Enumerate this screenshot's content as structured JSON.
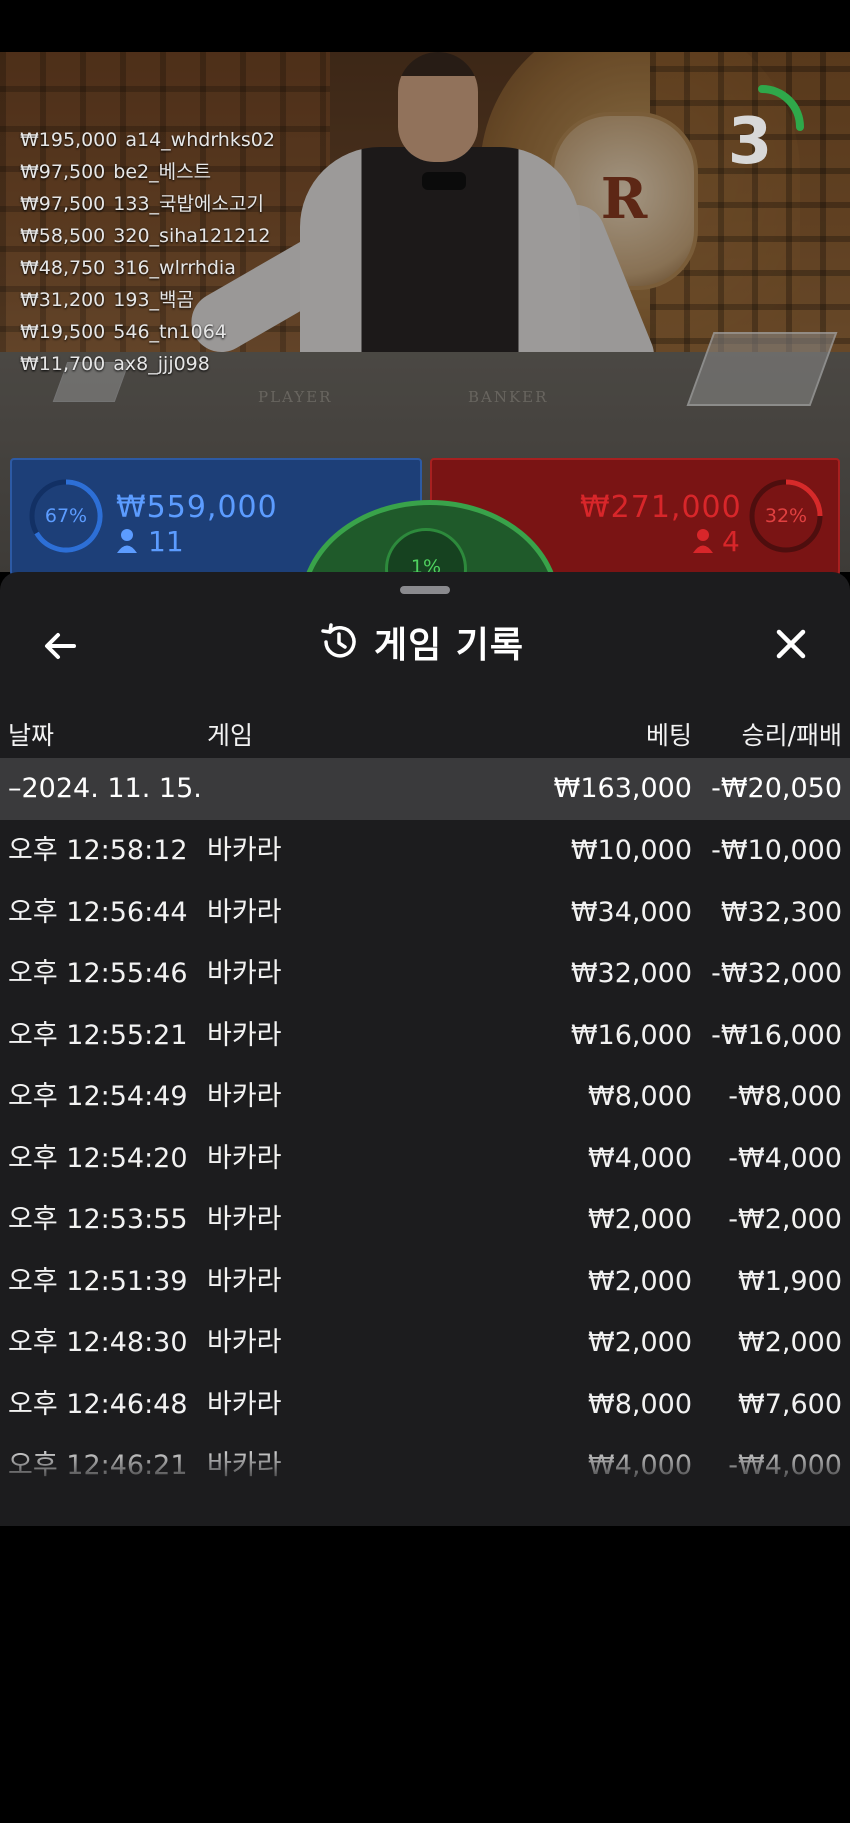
{
  "video": {
    "leaderboard": [
      {
        "amount": "₩195,000",
        "user": "a14_whdrhks02"
      },
      {
        "amount": "₩97,500",
        "user": "be2_베스트"
      },
      {
        "amount": "₩97,500",
        "user": "133_국밥에소고기"
      },
      {
        "amount": "₩58,500",
        "user": "320_siha121212"
      },
      {
        "amount": "₩48,750",
        "user": "316_wlrrhdia"
      },
      {
        "amount": "₩31,200",
        "user": "193_백곰"
      },
      {
        "amount": "₩19,500",
        "user": "546_tn1064"
      },
      {
        "amount": "₩11,700",
        "user": "ax8_jjj098"
      }
    ],
    "timer": "3",
    "table_labels": {
      "player": "PLAYER",
      "banker": "BANKER"
    },
    "emblem_letter": "R",
    "player": {
      "percent": "67%",
      "amount": "₩559,000",
      "count": "11",
      "color": "#2d6fd6"
    },
    "banker": {
      "percent": "32%",
      "amount": "₩271,000",
      "count": "4",
      "color": "#d62a2a"
    },
    "tie": {
      "percent": "1%",
      "color": "#39a34a"
    }
  },
  "sheet": {
    "title": "게임 기록",
    "columns": {
      "date": "날짜",
      "game": "게임",
      "bet": "베팅",
      "result": "승리/패배"
    },
    "date_group": {
      "date": "–2024. 11. 15.",
      "bet_total": "₩163,000",
      "result_total": "-₩20,050"
    },
    "rows": [
      {
        "time": "오후 12:58:12",
        "game": "바카라",
        "bet": "₩10,000",
        "result": "-₩10,000"
      },
      {
        "time": "오후 12:56:44",
        "game": "바카라",
        "bet": "₩34,000",
        "result": "₩32,300"
      },
      {
        "time": "오후 12:55:46",
        "game": "바카라",
        "bet": "₩32,000",
        "result": "-₩32,000"
      },
      {
        "time": "오후 12:55:21",
        "game": "바카라",
        "bet": "₩16,000",
        "result": "-₩16,000"
      },
      {
        "time": "오후 12:54:49",
        "game": "바카라",
        "bet": "₩8,000",
        "result": "-₩8,000"
      },
      {
        "time": "오후 12:54:20",
        "game": "바카라",
        "bet": "₩4,000",
        "result": "-₩4,000"
      },
      {
        "time": "오후 12:53:55",
        "game": "바카라",
        "bet": "₩2,000",
        "result": "-₩2,000"
      },
      {
        "time": "오후 12:51:39",
        "game": "바카라",
        "bet": "₩2,000",
        "result": "₩1,900"
      },
      {
        "time": "오후 12:48:30",
        "game": "바카라",
        "bet": "₩2,000",
        "result": "₩2,000"
      },
      {
        "time": "오후 12:46:48",
        "game": "바카라",
        "bet": "₩8,000",
        "result": "₩7,600"
      },
      {
        "time": "오후 12:46:21",
        "game": "바카라",
        "bet": "₩4,000",
        "result": "-₩4,000"
      }
    ],
    "icons": {
      "back": "arrow-left-icon",
      "history": "history-icon",
      "close": "close-icon"
    }
  }
}
